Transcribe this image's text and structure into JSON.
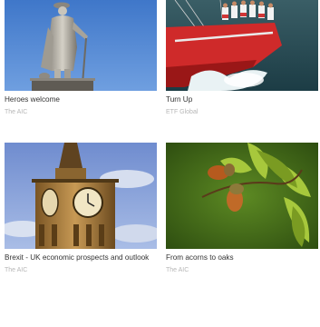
{
  "cards": [
    {
      "title": "Heroes welcome",
      "source": "The AIC",
      "image": "nelson-statue-image"
    },
    {
      "title": "Turn Up",
      "source": "ETF Global",
      "image": "sailing-yacht-image"
    },
    {
      "title": "Brexit - UK economic prospects and outlook",
      "source": "The AIC",
      "image": "big-ben-image"
    },
    {
      "title": "From acorns to oaks",
      "source": "The AIC",
      "image": "acorns-image"
    }
  ],
  "colors": {
    "title": "#333333",
    "source": "#b7b7b7"
  }
}
